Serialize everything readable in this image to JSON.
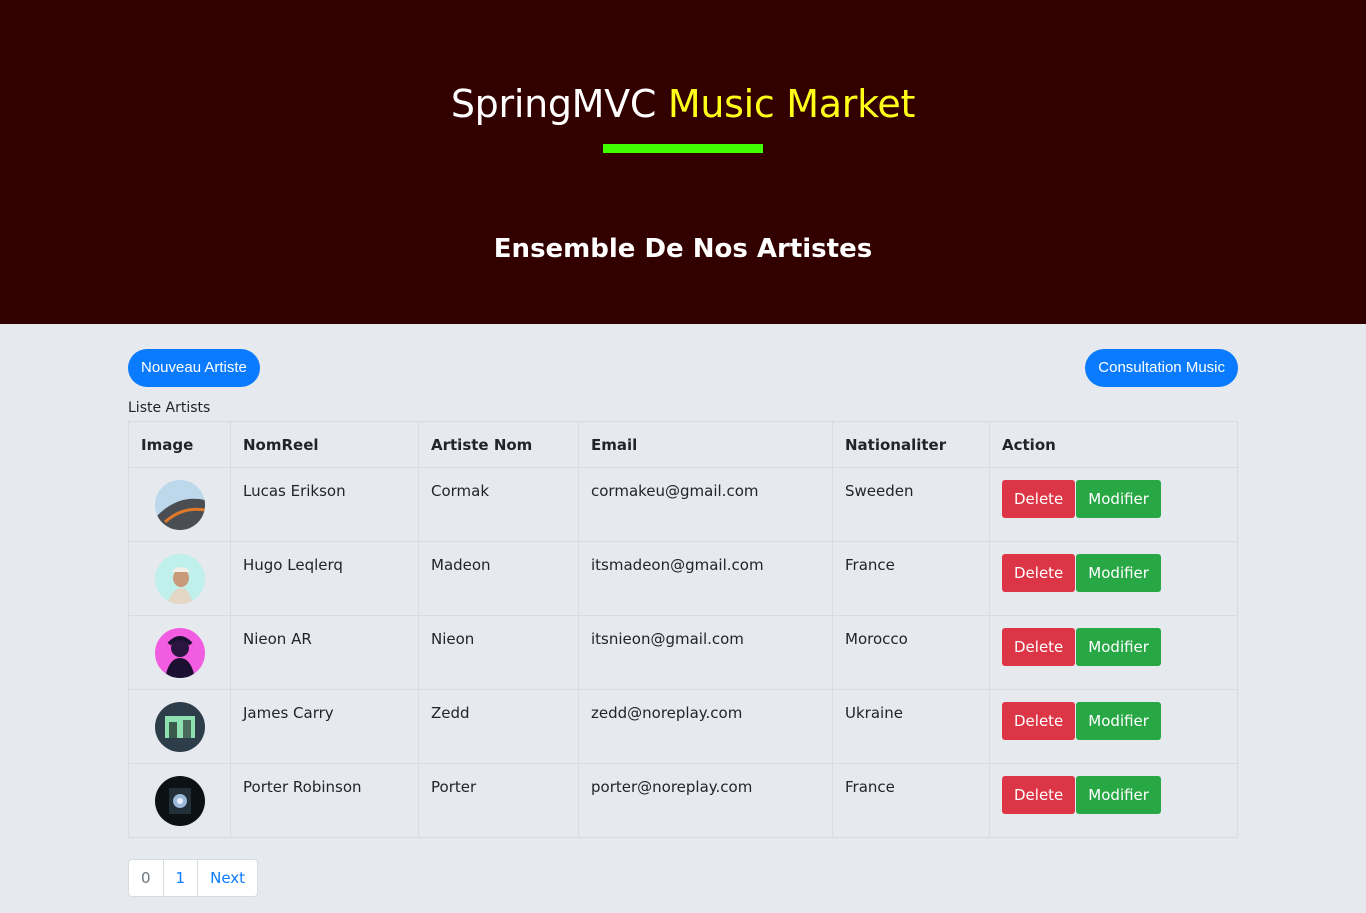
{
  "header": {
    "title_part1": "SpringMVC",
    "title_part2": "Music Market",
    "subtitle": "Ensemble De Nos Artistes",
    "accent_color": "#ffff1a",
    "underline_color": "#40ff00",
    "bg_color": "#330000"
  },
  "actions": {
    "new_artist": "Nouveau Artiste",
    "consult_music": "Consultation Music"
  },
  "table": {
    "caption": "Liste Artists",
    "headers": [
      "Image",
      "NomReel",
      "Artiste Nom",
      "Email",
      "Nationaliter",
      "Action"
    ],
    "rows": [
      {
        "nomreel": "Lucas Erikson",
        "artiste": "Cormak",
        "email": "cormakeu@gmail.com",
        "nationalite": "Sweeden"
      },
      {
        "nomreel": "Hugo Leqlerq",
        "artiste": "Madeon",
        "email": "itsmadeon@gmail.com",
        "nationalite": "France"
      },
      {
        "nomreel": "Nieon AR",
        "artiste": "Nieon",
        "email": "itsnieon@gmail.com",
        "nationalite": "Morocco"
      },
      {
        "nomreel": "James Carry",
        "artiste": "Zedd",
        "email": "zedd@noreplay.com",
        "nationalite": "Ukraine"
      },
      {
        "nomreel": "Porter Robinson",
        "artiste": "Porter",
        "email": "porter@noreplay.com",
        "nationalite": "France"
      }
    ],
    "delete_label": "Delete",
    "modify_label": "Modifier"
  },
  "pagination": {
    "pages": [
      "0",
      "1"
    ],
    "next": "Next"
  }
}
